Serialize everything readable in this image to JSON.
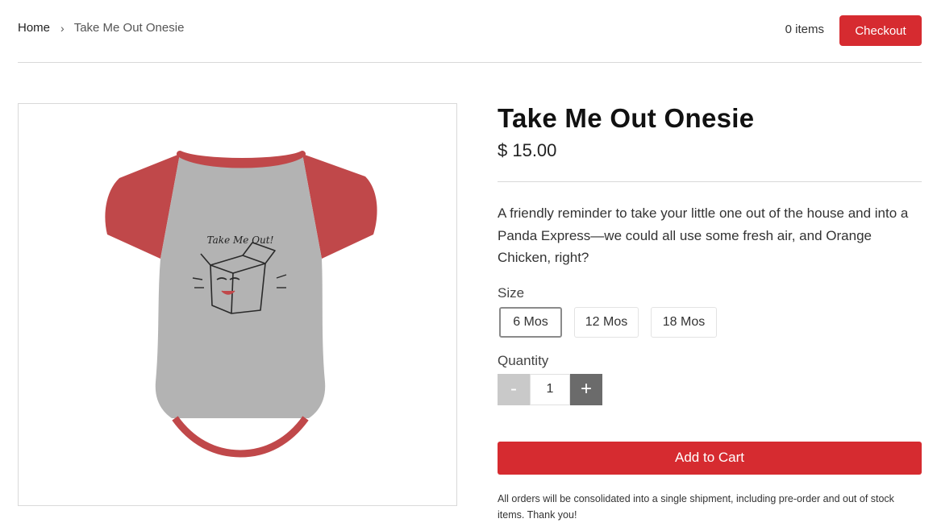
{
  "breadcrumb": {
    "home": "Home",
    "separator": "›",
    "current": "Take Me Out Onesie"
  },
  "cart": {
    "count_label": "0 items",
    "checkout_label": "Checkout"
  },
  "product": {
    "image_alt": "Take Me Out Onesie",
    "image_print_text": "Take Me Out!",
    "title": "Take Me Out Onesie",
    "price": "$ 15.00",
    "description": "A friendly reminder to take your little one out of the house and into a Panda Express—we could all use some fresh air, and Orange Chicken, right?"
  },
  "size": {
    "label": "Size",
    "options": [
      "6 Mos",
      "12 Mos",
      "18 Mos"
    ],
    "selected": "6 Mos"
  },
  "quantity": {
    "label": "Quantity",
    "value": "1",
    "minus_label": "-",
    "plus_label": "+"
  },
  "add_to_cart_label": "Add to Cart",
  "shipping_note": "All orders will be consolidated into a single shipment, including pre-order and out of stock items. Thank you!",
  "colors": {
    "accent": "#d62b30",
    "sleeve_red": "#c0484a",
    "body_gray": "#b3b3b3"
  }
}
